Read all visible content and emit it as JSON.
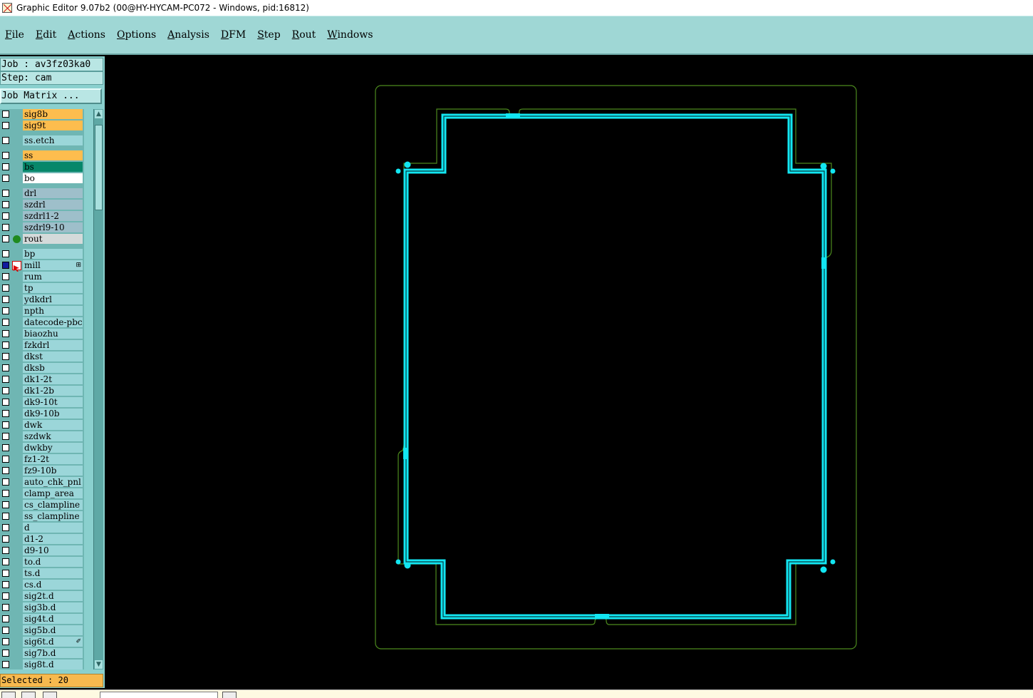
{
  "window": {
    "title": "Graphic Editor 9.07b2 (00@HY-HYCAM-PC072 - Windows, pid:16812)"
  },
  "menubar": {
    "items": [
      {
        "label": "File"
      },
      {
        "label": "Edit"
      },
      {
        "label": "Actions"
      },
      {
        "label": "Options"
      },
      {
        "label": "Analysis"
      },
      {
        "label": "DFM"
      },
      {
        "label": "Step"
      },
      {
        "label": "Rout"
      },
      {
        "label": "Windows"
      }
    ]
  },
  "panel": {
    "job_label": "Job : av3fz03ka0",
    "step_label": "Step: cam",
    "job_matrix_button": "Job Matrix ...",
    "status": "Selected : 20"
  },
  "colors": {
    "signal": "#fdbd4e",
    "solder_mask_bottom": "#07876a",
    "silk": "#ffffff",
    "drill": "#9ebfca",
    "rout": "#d4dada",
    "document": "#9bd6d9",
    "rout_indicator": "#1f8a1f",
    "outline_green": "#4c8a1e",
    "rout_path_cyan": "#12e6f2"
  },
  "layers": [
    {
      "name": "sig8b",
      "color": "#fdbd4e"
    },
    {
      "name": "sig9t",
      "color": "#fdbd4e"
    },
    {
      "name": "ss.etch",
      "color": "#9bd6d9"
    },
    {
      "name": "ss",
      "color": "#fdbd4e"
    },
    {
      "name": "bs",
      "color": "#07876a"
    },
    {
      "name": "bo",
      "color": "#ffffff"
    },
    {
      "name": "drl",
      "color": "#9ebfca"
    },
    {
      "name": "szdrl",
      "color": "#9ebfca"
    },
    {
      "name": "szdrl1-2",
      "color": "#9ebfca"
    },
    {
      "name": "szdrl9-10",
      "color": "#9ebfca"
    },
    {
      "name": "rout",
      "color": "#d4dada",
      "indicator": "green-dot"
    },
    {
      "name": "bp",
      "color": "#9bd6d9"
    },
    {
      "name": "mill",
      "color": "#9bd6d9",
      "checked": true,
      "indicator": "edit-arrow"
    },
    {
      "name": "rum",
      "color": "#9bd6d9"
    },
    {
      "name": "tp",
      "color": "#9bd6d9"
    },
    {
      "name": "ydkdrl",
      "color": "#9bd6d9"
    },
    {
      "name": "npth",
      "color": "#9bd6d9"
    },
    {
      "name": "datecode-pbc",
      "color": "#9bd6d9"
    },
    {
      "name": "biaozhu",
      "color": "#9bd6d9"
    },
    {
      "name": "fzkdrl",
      "color": "#9bd6d9"
    },
    {
      "name": "dkst",
      "color": "#9bd6d9"
    },
    {
      "name": "dksb",
      "color": "#9bd6d9"
    },
    {
      "name": "dk1-2t",
      "color": "#9bd6d9"
    },
    {
      "name": "dk1-2b",
      "color": "#9bd6d9"
    },
    {
      "name": "dk9-10t",
      "color": "#9bd6d9"
    },
    {
      "name": "dk9-10b",
      "color": "#9bd6d9"
    },
    {
      "name": "dwk",
      "color": "#9bd6d9"
    },
    {
      "name": "szdwk",
      "color": "#9bd6d9"
    },
    {
      "name": "dwkby",
      "color": "#9bd6d9"
    },
    {
      "name": "fz1-2t",
      "color": "#9bd6d9"
    },
    {
      "name": "fz9-10b",
      "color": "#9bd6d9"
    },
    {
      "name": "auto_chk_pnl",
      "color": "#9bd6d9"
    },
    {
      "name": "clamp_area",
      "color": "#9bd6d9"
    },
    {
      "name": "cs_clampline",
      "color": "#9bd6d9"
    },
    {
      "name": "ss_clampline",
      "color": "#9bd6d9"
    },
    {
      "name": "d",
      "color": "#9bd6d9"
    },
    {
      "name": "d1-2",
      "color": "#9bd6d9"
    },
    {
      "name": "d9-10",
      "color": "#9bd6d9"
    },
    {
      "name": "to.d",
      "color": "#9bd6d9"
    },
    {
      "name": "ts.d",
      "color": "#9bd6d9"
    },
    {
      "name": "cs.d",
      "color": "#9bd6d9"
    },
    {
      "name": "sig2t.d",
      "color": "#9bd6d9"
    },
    {
      "name": "sig3b.d",
      "color": "#9bd6d9"
    },
    {
      "name": "sig4t.d",
      "color": "#9bd6d9"
    },
    {
      "name": "sig5b.d",
      "color": "#9bd6d9"
    },
    {
      "name": "sig6t.d",
      "color": "#9bd6d9"
    },
    {
      "name": "sig7b.d",
      "color": "#9bd6d9"
    },
    {
      "name": "sig8t.d",
      "color": "#9bd6d9"
    }
  ]
}
